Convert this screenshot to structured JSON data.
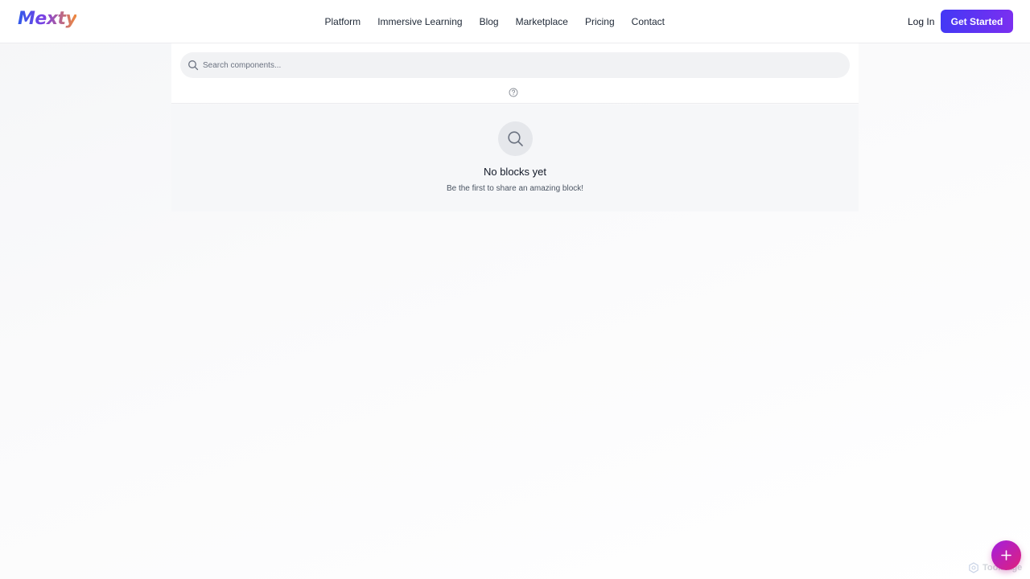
{
  "header": {
    "logo": "Mexty",
    "nav": [
      "Platform",
      "Immersive Learning",
      "Blog",
      "Marketplace",
      "Pricing",
      "Contact"
    ],
    "login": "Log In",
    "cta": "Get Started"
  },
  "search": {
    "placeholder": "Search components..."
  },
  "empty_state": {
    "title": "No blocks yet",
    "subtitle": "Be the first to share an amazing block!"
  },
  "watermark": "ToolHage",
  "icons": {
    "search": "search-icon",
    "help": "help-circle-icon",
    "empty": "search-icon",
    "fab": "plus-icon",
    "watermark": "hexagon-logo-icon"
  },
  "colors": {
    "cta_start": "#4338f5",
    "cta_end": "#7b2ff0",
    "fab_start": "#a21fe0",
    "fab_end": "#e0207a"
  }
}
